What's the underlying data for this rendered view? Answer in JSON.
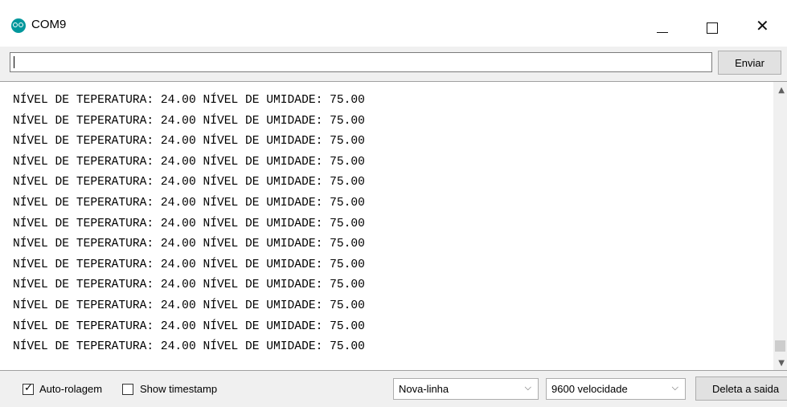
{
  "window": {
    "title": "COM9"
  },
  "send": {
    "input_value": "",
    "button_label": "Enviar"
  },
  "output": {
    "lines": [
      "NÍVEL DE TEPERATURA: 24.00 NÍVEL DE UMIDADE: 75.00",
      "NÍVEL DE TEPERATURA: 24.00 NÍVEL DE UMIDADE: 75.00",
      "NÍVEL DE TEPERATURA: 24.00 NÍVEL DE UMIDADE: 75.00",
      "NÍVEL DE TEPERATURA: 24.00 NÍVEL DE UMIDADE: 75.00",
      "NÍVEL DE TEPERATURA: 24.00 NÍVEL DE UMIDADE: 75.00",
      "NÍVEL DE TEPERATURA: 24.00 NÍVEL DE UMIDADE: 75.00",
      "NÍVEL DE TEPERATURA: 24.00 NÍVEL DE UMIDADE: 75.00",
      "NÍVEL DE TEPERATURA: 24.00 NÍVEL DE UMIDADE: 75.00",
      "NÍVEL DE TEPERATURA: 24.00 NÍVEL DE UMIDADE: 75.00",
      "NÍVEL DE TEPERATURA: 24.00 NÍVEL DE UMIDADE: 75.00",
      "NÍVEL DE TEPERATURA: 24.00 NÍVEL DE UMIDADE: 75.00",
      "NÍVEL DE TEPERATURA: 24.00 NÍVEL DE UMIDADE: 75.00",
      "NÍVEL DE TEPERATURA: 24.00 NÍVEL DE UMIDADE: 75.00"
    ]
  },
  "footer": {
    "autoscroll_label": "Auto-rolagem",
    "autoscroll_checked": true,
    "timestamp_label": "Show timestamp",
    "timestamp_checked": false,
    "line_ending": "Nova-linha",
    "baud_rate": "9600 velocidade",
    "clear_label": "Deleta a saida"
  },
  "colors": {
    "app_icon": "#00979c"
  }
}
